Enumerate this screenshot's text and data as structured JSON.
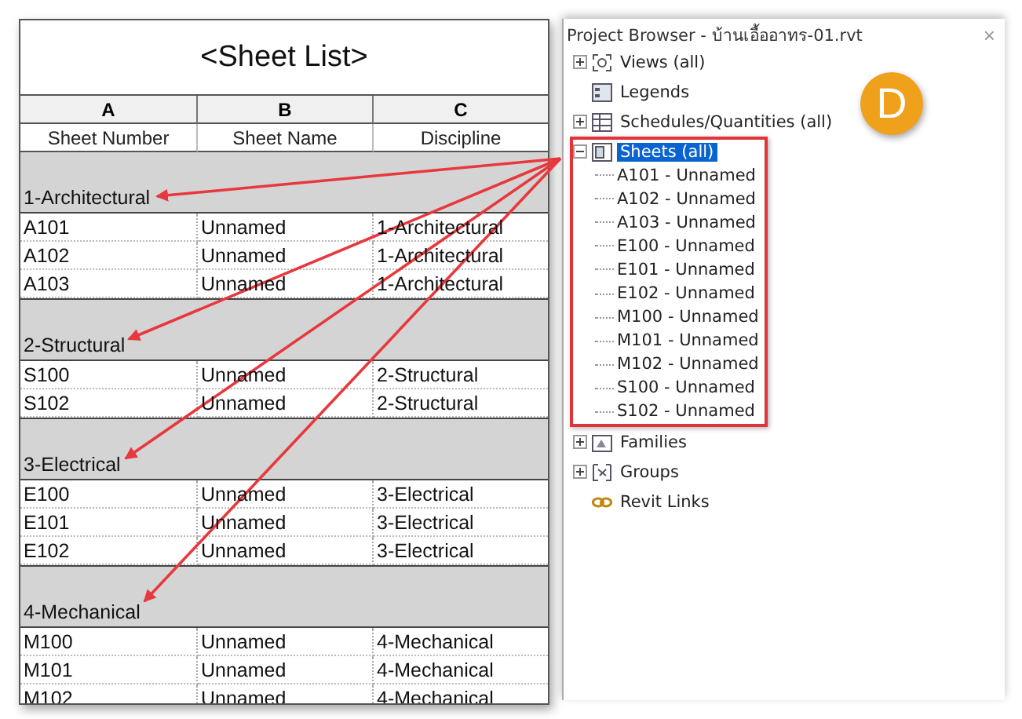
{
  "schedule": {
    "title": "<Sheet List>",
    "columns": [
      {
        "letter": "A",
        "name": "Sheet Number"
      },
      {
        "letter": "B",
        "name": "Sheet Name"
      },
      {
        "letter": "C",
        "name": "Discipline"
      }
    ],
    "groups": [
      {
        "name": "1-Architectural",
        "rows": [
          [
            "A101",
            "Unnamed",
            "1-Architectural"
          ],
          [
            "A102",
            "Unnamed",
            "1-Architectural"
          ],
          [
            "A103",
            "Unnamed",
            "1-Architectural"
          ]
        ]
      },
      {
        "name": "2-Structural",
        "rows": [
          [
            "S100",
            "Unnamed",
            "2-Structural"
          ],
          [
            "S102",
            "Unnamed",
            "2-Structural"
          ]
        ]
      },
      {
        "name": "3-Electrical",
        "rows": [
          [
            "E100",
            "Unnamed",
            "3-Electrical"
          ],
          [
            "E101",
            "Unnamed",
            "3-Electrical"
          ],
          [
            "E102",
            "Unnamed",
            "3-Electrical"
          ]
        ]
      },
      {
        "name": "4-Mechanical",
        "rows": [
          [
            "M100",
            "Unnamed",
            "4-Mechanical"
          ],
          [
            "M101",
            "Unnamed",
            "4-Mechanical"
          ],
          [
            "M102",
            "Unnamed",
            "4-Mechanical"
          ]
        ]
      }
    ]
  },
  "project_browser": {
    "title": "Project Browser - บ้านเอื้ออาทร-01.rvt",
    "close": "×",
    "badge": {
      "label": "D"
    },
    "items": [
      {
        "label": "Views (all)",
        "kind": "views",
        "expanded": false,
        "selected": false,
        "highlighted": false
      },
      {
        "label": "Legends",
        "kind": "legends",
        "selected": false,
        "highlighted": false
      },
      {
        "label": "Schedules/Quantities (all)",
        "kind": "schedules",
        "expanded": false,
        "selected": false,
        "highlighted": false
      },
      {
        "label": "Sheets (all)",
        "kind": "sheets",
        "expanded": true,
        "selected": true,
        "highlighted": true,
        "children": [
          {
            "label": "A101 - Unnamed",
            "selected": false
          },
          {
            "label": "A102 - Unnamed",
            "selected": false
          },
          {
            "label": "A103 - Unnamed",
            "selected": false
          },
          {
            "label": "E100 - Unnamed",
            "selected": false
          },
          {
            "label": "E101 - Unnamed",
            "selected": false
          },
          {
            "label": "E102 - Unnamed",
            "selected": false
          },
          {
            "label": "M100 - Unnamed",
            "selected": false
          },
          {
            "label": "M101 - Unnamed",
            "selected": false
          },
          {
            "label": "M102 - Unnamed",
            "selected": false
          },
          {
            "label": "S100 - Unnamed",
            "selected": false
          },
          {
            "label": "S102 - Unnamed",
            "selected": false
          }
        ]
      },
      {
        "label": "Families",
        "kind": "families",
        "expanded": false,
        "selected": false,
        "highlighted": false
      },
      {
        "label": "Groups",
        "kind": "groups",
        "expanded": false,
        "selected": false,
        "highlighted": false
      },
      {
        "label": "Revit Links",
        "kind": "links",
        "selected": false,
        "highlighted": false
      }
    ]
  }
}
